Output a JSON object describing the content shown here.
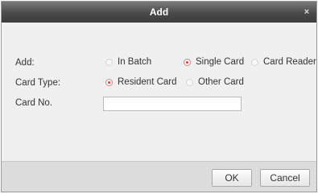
{
  "dialog": {
    "title": "Add",
    "close_glyph": "×"
  },
  "form": {
    "add_label": "Add:",
    "add_options": [
      {
        "label": "In Batch",
        "checked": false
      },
      {
        "label": "Single Card",
        "checked": true
      },
      {
        "label": "Card Reader",
        "checked": false
      }
    ],
    "card_type_label": "Card Type:",
    "card_type_options": [
      {
        "label": "Resident Card",
        "checked": true
      },
      {
        "label": "Other Card",
        "checked": false
      }
    ],
    "card_no_label": "Card No.",
    "card_no_value": ""
  },
  "buttons": {
    "ok": "OK",
    "cancel": "Cancel"
  }
}
